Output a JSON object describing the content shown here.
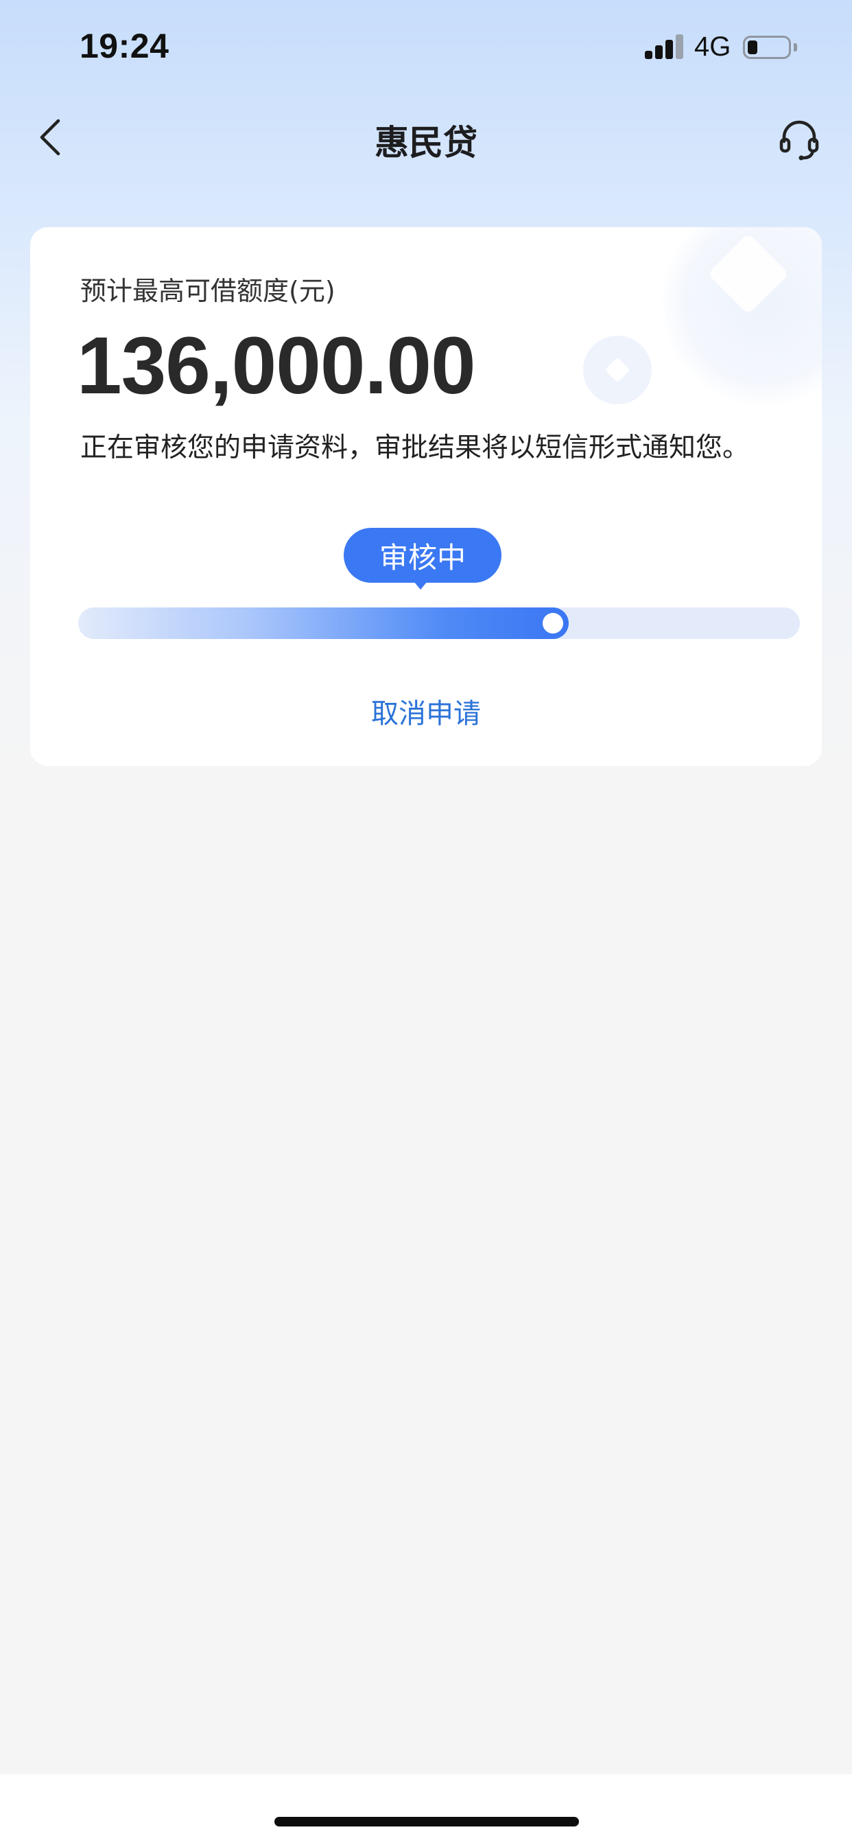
{
  "status_bar": {
    "time": "19:24",
    "network": "4G"
  },
  "nav": {
    "title": "惠民贷",
    "back_icon": "chevron-left-icon",
    "service_icon": "headset-icon"
  },
  "card": {
    "credit_label": "预计最高可借额度(元)",
    "credit_amount": "136,000.00",
    "review_text": "正在审核您的申请资料，审批结果将以短信形式通知您。",
    "status_tag": "审核中",
    "progress": 0.68,
    "cancel_label": "取消申请"
  },
  "colors": {
    "accent": "#3b78f3",
    "link": "#2b73d8",
    "background": "#f5f5f5"
  }
}
